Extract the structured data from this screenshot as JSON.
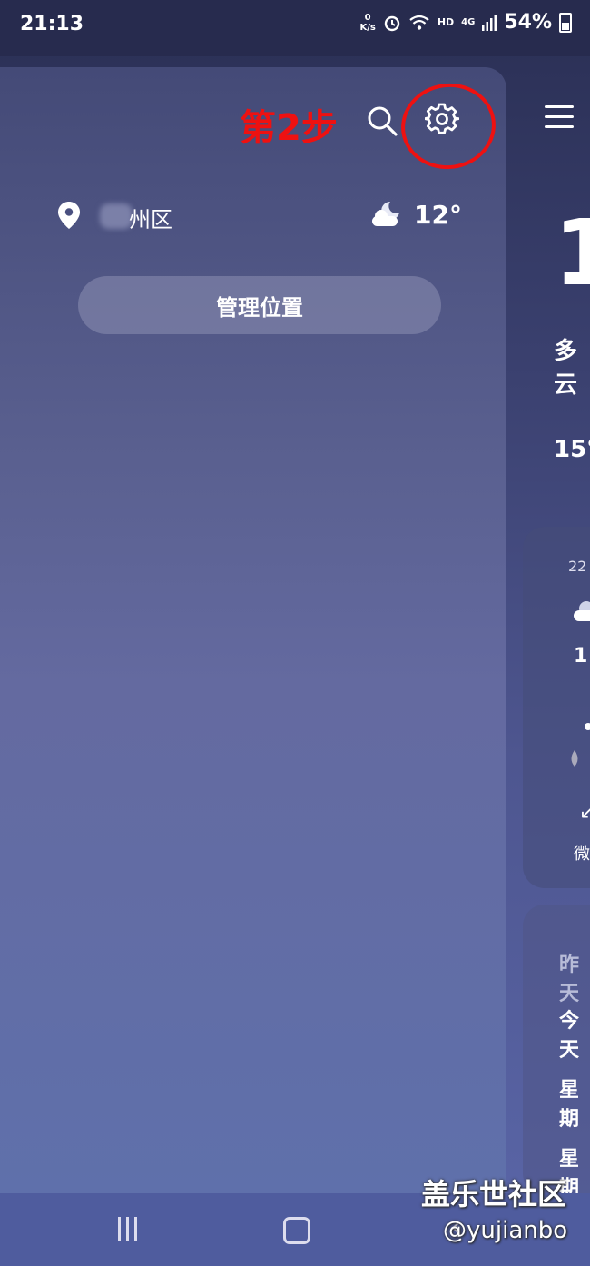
{
  "status_bar": {
    "time": "21:13",
    "net_speed_value": "0",
    "net_speed_unit": "K/s",
    "network_label": "HD",
    "signal_label": "4G",
    "battery": "54%"
  },
  "drawer": {
    "annotation": "第2步",
    "location": {
      "name": "州区",
      "temperature": "12°"
    },
    "manage_button": "管理位置"
  },
  "background_panel": {
    "big_temp": "1",
    "condition": "多云",
    "high_low": "15°",
    "hourly_time": "22",
    "hourly_temp": "1",
    "wind": "微",
    "days": [
      "昨天",
      "今天",
      "星期",
      "星期"
    ]
  },
  "watermark": {
    "community": "盖乐世社区",
    "user": "@yujianbo"
  }
}
